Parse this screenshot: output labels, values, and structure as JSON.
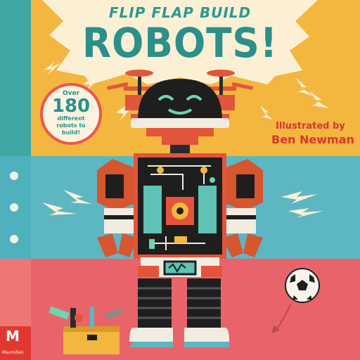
{
  "cover": {
    "subtitle": "FLIP FLAP BUILD",
    "title": "ROBOTS!",
    "badge": {
      "over": "Over",
      "number": "180",
      "rest": "different robots to build!"
    },
    "illustrated_by": "Illustrated by",
    "illustrator": "Ben Newman",
    "publisher_logo": "M",
    "publisher_name": "Macmillan"
  },
  "colors": {
    "top_band": "#f3b63f",
    "middle_band": "#5db7c2",
    "bottom_band": "#e9646a",
    "title_teal": "#2b8f8a",
    "accent_red": "#e3382f"
  },
  "icons": [
    "robot-head-icon",
    "propeller-icon",
    "lightning-bolt-icon",
    "circuit-board-icon",
    "robot-arm-icon",
    "robot-leg-icon",
    "soccer-ball-icon",
    "toolbox-icon",
    "publisher-logo-icon"
  ]
}
